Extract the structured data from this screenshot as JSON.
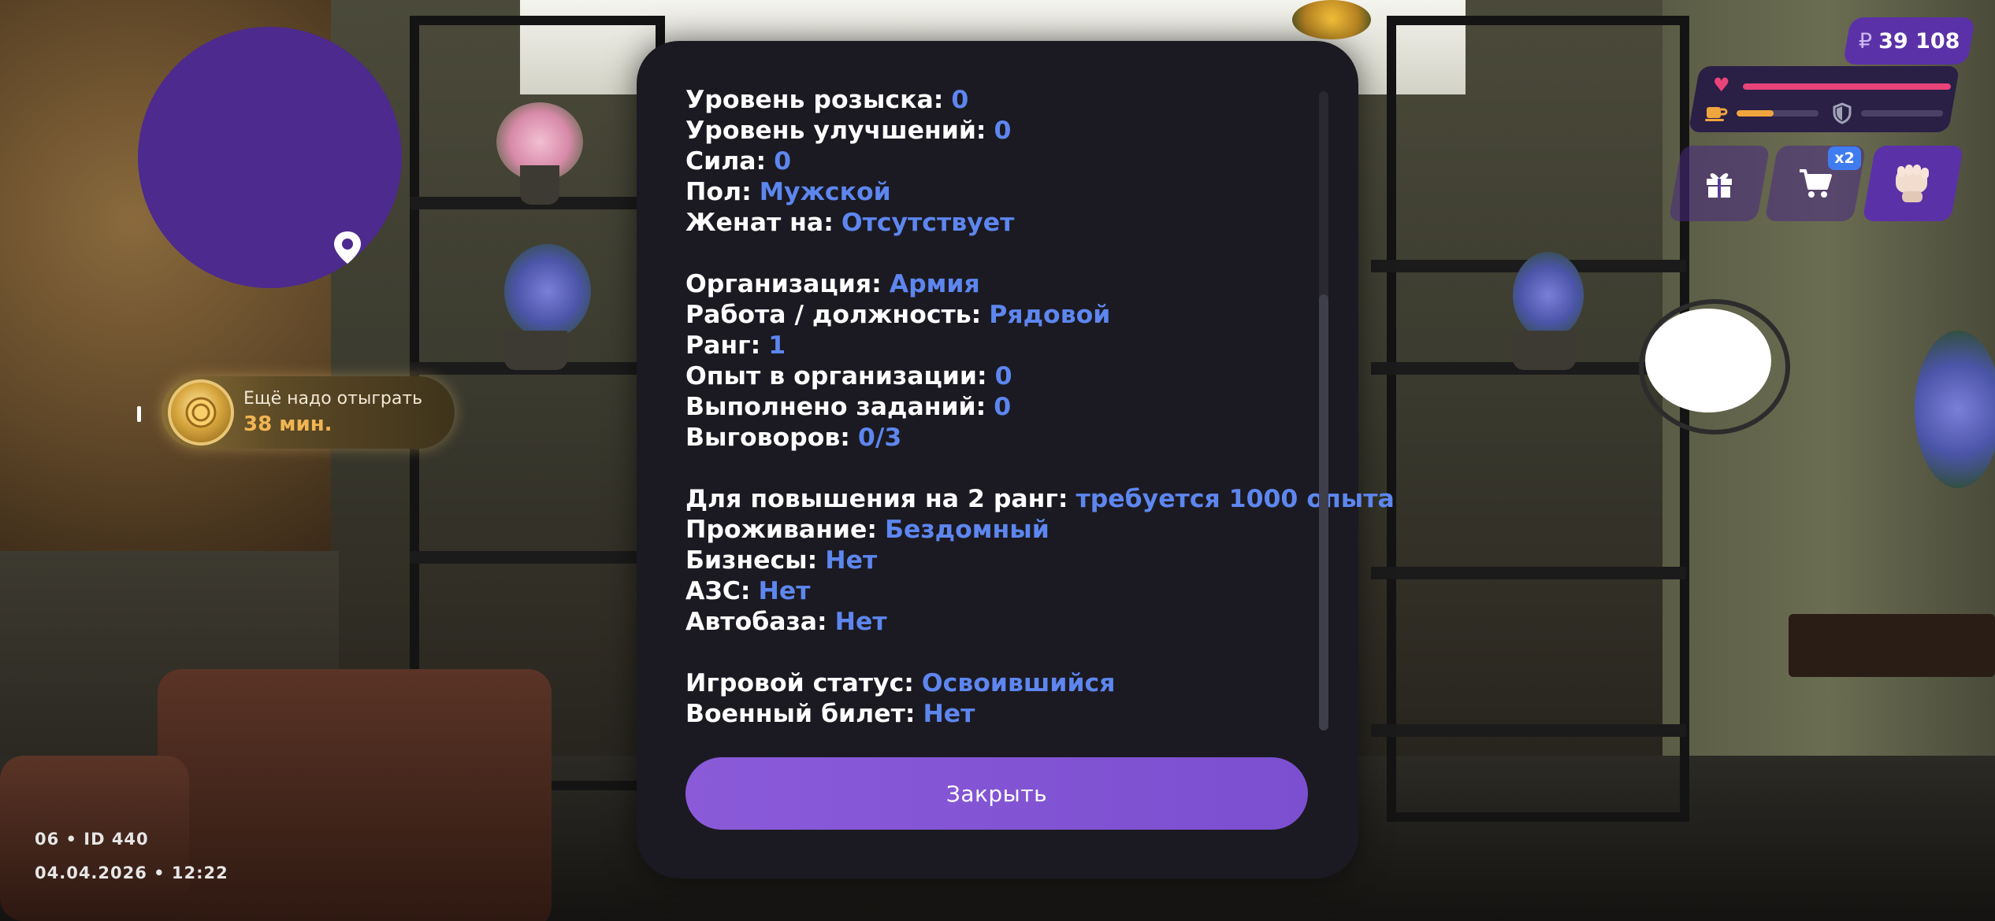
{
  "hud": {
    "money": {
      "symbol": "₽",
      "amount": "39 108"
    },
    "stats": {
      "health": 1.0,
      "hunger": 0.45,
      "armor": 0.0,
      "colors": {
        "health": "#e8447a",
        "hunger": "#f0a53e",
        "armor": "#a0a3b6"
      }
    },
    "quick_buttons": [
      "gift-icon",
      "cart-icon",
      "fist-icon"
    ],
    "cart_badge": "x2",
    "playtime": {
      "label": "Ещё надо отыграть",
      "value": "38 мин."
    },
    "footer": {
      "server_line": "06 • ID 440",
      "datetime": "04.04.2026 • 12:22"
    }
  },
  "dialog": {
    "rows": [
      {
        "label": "Уровень розыска:",
        "value": "0"
      },
      {
        "label": "Уровень улучшений:",
        "value": "0"
      },
      {
        "label": "Сила:",
        "value": "0"
      },
      {
        "label": "Пол:",
        "value": "Мужской"
      },
      {
        "label": "Женат на:",
        "value": "Отсутствует"
      },
      {
        "gap": true
      },
      {
        "label": "Организация:",
        "value": "Армия"
      },
      {
        "label": "Работа / должность:",
        "value": "Рядовой"
      },
      {
        "label": "Ранг:",
        "value": "1"
      },
      {
        "label": "Опыт в организации:",
        "value": "0"
      },
      {
        "label": "Выполнено заданий:",
        "value": "0"
      },
      {
        "label": "Выговоров:",
        "value": "0/3"
      },
      {
        "gap": true
      },
      {
        "label": "Для повышения на 2 ранг:",
        "value": "требуется 1000 опыта"
      },
      {
        "label": "Проживание:",
        "value": "Бездомный"
      },
      {
        "label": "Бизнесы:",
        "value": "Нет"
      },
      {
        "label": "АЗС:",
        "value": "Нет"
      },
      {
        "label": "Автобаза:",
        "value": "Нет"
      },
      {
        "gap": true
      },
      {
        "label": "Игровой статус:",
        "value": "Освоившийся"
      },
      {
        "label": "Военный билет:",
        "value": "Нет"
      }
    ],
    "close_label": "Закрыть",
    "colors": {
      "value": "#5d86ef",
      "button": "#8152d6"
    }
  }
}
